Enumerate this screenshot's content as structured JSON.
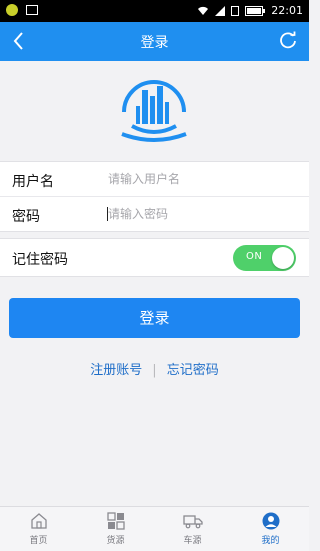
{
  "status_bar": {
    "time": "22:01"
  },
  "nav": {
    "title": "登录"
  },
  "form": {
    "username": {
      "label": "用户名",
      "placeholder": "请输入用户名"
    },
    "password": {
      "label": "密码",
      "placeholder": "请输入密码"
    },
    "remember": {
      "label": "记住密码",
      "toggle_text": "ON"
    }
  },
  "login_button": "登录",
  "links": {
    "register": "注册账号",
    "separator": "|",
    "forgot": "忘记密码"
  },
  "tabs": [
    {
      "label": "首页"
    },
    {
      "label": "货源"
    },
    {
      "label": "车源"
    },
    {
      "label": "我的"
    }
  ],
  "colors": {
    "brand": "#1f8ff0",
    "toggle_on": "#4fd06a",
    "link": "#1f6ec8"
  }
}
